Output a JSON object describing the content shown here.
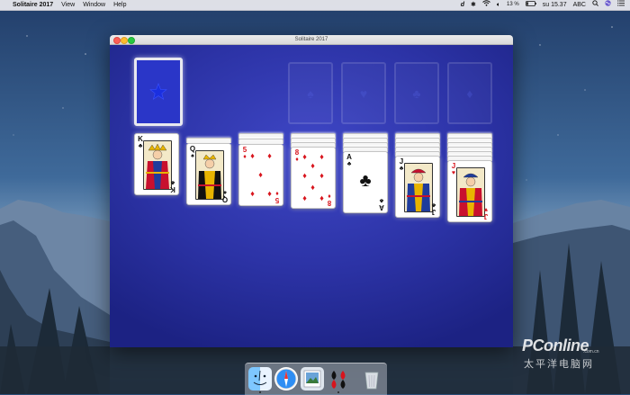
{
  "menubar": {
    "apple_glyph": "",
    "app_name": "Solitaire 2017",
    "menus": [
      "View",
      "Window",
      "Help"
    ],
    "battery_text": "13 %",
    "clock": "su 15.37",
    "input_source": "ABC"
  },
  "window": {
    "title": "Solitaire 2017"
  },
  "colors": {
    "felt": "#2c33a6",
    "card_back": "#2a36c8",
    "red_suit": "#d8141c"
  },
  "game": {
    "stock": {
      "face_down": true
    },
    "foundations": [
      {
        "suit_hint": "♠",
        "empty": true
      },
      {
        "suit_hint": "♥",
        "empty": true
      },
      {
        "suit_hint": "♣",
        "empty": true
      },
      {
        "suit_hint": "♦",
        "empty": true
      }
    ],
    "tableau": [
      {
        "hidden": 0,
        "top": {
          "rank": "K",
          "suit": "♣",
          "color": "black"
        }
      },
      {
        "hidden": 1,
        "top": {
          "rank": "Q",
          "suit": "♠",
          "color": "black"
        }
      },
      {
        "hidden": 2,
        "top": {
          "rank": "5",
          "suit": "♦",
          "color": "red"
        }
      },
      {
        "hidden": 3,
        "top": {
          "rank": "8",
          "suit": "♦",
          "color": "red"
        }
      },
      {
        "hidden": 4,
        "top": {
          "rank": "A",
          "suit": "♣",
          "color": "black"
        }
      },
      {
        "hidden": 5,
        "top": {
          "rank": "J",
          "suit": "♣",
          "color": "black"
        }
      },
      {
        "hidden": 6,
        "top": {
          "rank": "J",
          "suit": "♥",
          "color": "red"
        }
      }
    ]
  },
  "dock": {
    "items": [
      "finder-icon",
      "safari-icon",
      "preview-icon",
      "solitaire-icon",
      "trash-icon"
    ]
  },
  "watermark": {
    "logo_main": "PConline",
    "domain": ".com.cn",
    "subtitle": "太平洋电脑网"
  }
}
